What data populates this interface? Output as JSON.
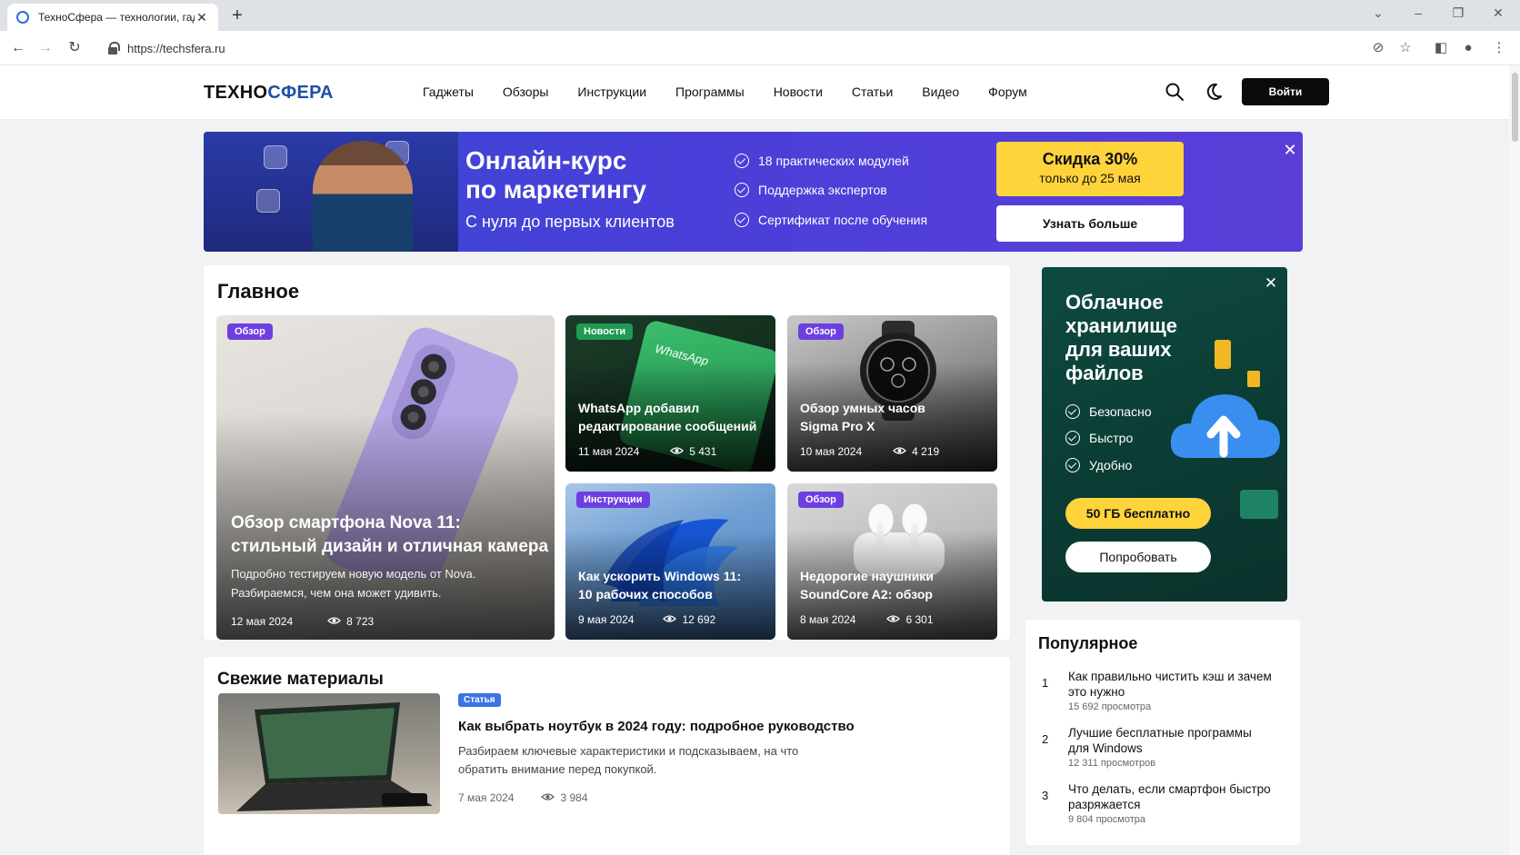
{
  "browser": {
    "tab_title": "ТехноСфера — технологии, гад",
    "url": "https://techsfera.ru"
  },
  "site": {
    "logo_part1": "ТЕХНО",
    "logo_part2": "СФЕРА",
    "nav": [
      "Гаджеты",
      "Обзоры",
      "Инструкции",
      "Программы",
      "Новости",
      "Статьи",
      "Видео",
      "Форум"
    ],
    "login": "Войти"
  },
  "banner": {
    "title_line1": "Онлайн-курс",
    "title_line2": "по маркетингу",
    "subtitle": "С нуля до первых клиентов",
    "features": [
      "18 практических модулей",
      "Поддержка экспертов",
      "Сертификат после обучения"
    ],
    "discount_line1": "Скидка 30%",
    "discount_line2": "только до 25 мая",
    "cta": "Узнать больше"
  },
  "main": {
    "title": "Главное",
    "featured": {
      "badge": "Обзор",
      "title_line1": "Обзор смартфона Nova 11:",
      "title_line2": "стильный дизайн и отличная камера",
      "desc_line1": "Подробно тестируем новую модель от Nova.",
      "desc_line2": "Разбираемся, чем она может удивить.",
      "date": "12 мая 2024",
      "views": "8 723"
    },
    "tiles": [
      {
        "badge": "Новости",
        "line1": "WhatsApp добавил",
        "line2": "редактирование сообщений",
        "date": "11 мая 2024",
        "views": "5 431",
        "img_text": "WhatsApp"
      },
      {
        "badge": "Обзор",
        "line1": "Обзор умных часов",
        "line2": "Sigma Pro X",
        "date": "10 мая 2024",
        "views": "4 219"
      },
      {
        "badge": "Инструкции",
        "line1": "Как ускорить Windows 11:",
        "line2": "10 рабочих способов",
        "date": "9 мая 2024",
        "views": "12 692"
      },
      {
        "badge": "Обзор",
        "line1": "Недорогие наушники",
        "line2": "SoundCore A2: обзор",
        "date": "8 мая 2024",
        "views": "6 301"
      }
    ]
  },
  "side_ad": {
    "title_lines": [
      "Облачное",
      "хранилище",
      "для ваших",
      "файлов"
    ],
    "features": [
      "Безопасно",
      "Быстро",
      "Удобно"
    ],
    "offer": "50 ГБ бесплатно",
    "cta": "Попробовать"
  },
  "popular": {
    "title": "Популярное",
    "items": [
      {
        "num": "1",
        "line1": "Как правильно чистить кэш и зачем",
        "line2": "это нужно",
        "views": "15 692 просмотра"
      },
      {
        "num": "2",
        "line1": "Лучшие бесплатные программы",
        "line2": "для Windows",
        "views": "12 311 просмотров"
      },
      {
        "num": "3",
        "line1": "Что делать, если смартфон быстро",
        "line2": "разряжается",
        "views": "9 804 просмотра"
      }
    ]
  },
  "fresh": {
    "title": "Свежие материалы",
    "article": {
      "badge": "Статья",
      "title": "Как выбрать ноутбук в 2024 году: подробное руководство",
      "desc_line1": "Разбираем ключевые характеристики и подсказываем, на что",
      "desc_line2": "обратить внимание перед покупкой.",
      "date": "7 мая 2024",
      "views": "3 984"
    }
  },
  "colors": {
    "brand_blue": "#1f4fa8",
    "banner_purple": "#4a3fd8",
    "accent_yellow": "#ffd43b",
    "badge_purple": "#6d3fe0",
    "badge_green": "#1f9a52",
    "ad_green": "#0e4a40"
  }
}
